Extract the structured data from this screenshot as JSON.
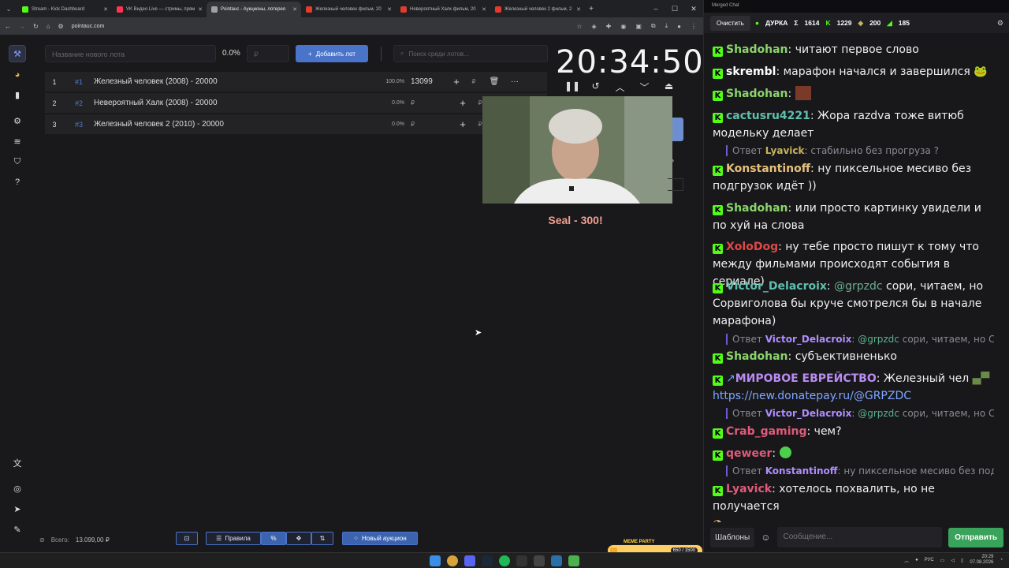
{
  "tabs": [
    {
      "label": "Stream - Kick Dashboard",
      "color": "#53fc18"
    },
    {
      "label": "VK Видео Live — стримы, прям",
      "color": "#ff3355"
    },
    {
      "label": "Pointauc - Аукционы, лотерея",
      "color": "#a0a0a0",
      "active": true
    },
    {
      "label": "Железный человек фильм, 20",
      "color": "#e23c2c"
    },
    {
      "label": "Невероятный Халк фильм, 20",
      "color": "#e23c2c"
    },
    {
      "label": "Железный человек 2 фильм, 2",
      "color": "#e23c2c"
    }
  ],
  "url": "pointauc.com",
  "controls": {
    "lot_placeholder": "Название нового лота",
    "percent": "0.0%",
    "amount_placeholder": "₽",
    "add_lot": "Добавить лот",
    "search_placeholder": "Поиск среди лотов..."
  },
  "lots": [
    {
      "num": "1",
      "id": "#1",
      "title": "Железный человек (2008) - 20000",
      "pct": "100.0%",
      "value": "13099",
      "cur": "₽"
    },
    {
      "num": "2",
      "id": "#2",
      "title": "Невероятный Халк (2008) - 20000",
      "pct": "0.0%",
      "value": "",
      "cur": "₽"
    },
    {
      "num": "3",
      "id": "#3",
      "title": "Железный человек 2 (2010) - 20000",
      "pct": "0.0%",
      "value": "",
      "cur": "₽"
    }
  ],
  "timer": "20:34:50",
  "seal": "Seal - 300!",
  "footer": {
    "total_label": "Всего:",
    "total_value": "13.099,00 ₽",
    "rules": "Правила",
    "new_auction": "Новый аукцион"
  },
  "chat": {
    "title": "Merged Chat",
    "clear": "Очистить",
    "streamer": "ДУРКА",
    "stats": [
      "1614",
      "1229",
      "200",
      "185"
    ],
    "templates": "Шаблоны",
    "input_placeholder": "Сообщение...",
    "send": "Отправить",
    "messages": [
      {
        "user": "Shadohan",
        "color": "#8bd36b",
        "text": "читают первое слово"
      },
      {
        "user": "skrembl",
        "color": "#fff",
        "text": "марафон начался и завершился"
      },
      {
        "user": "Shadohan",
        "color": "#8bd36b",
        "text": ""
      },
      {
        "user": "cactusru4221",
        "color": "#5fbfae",
        "text": "Жора razdva тоже витюб модельку делает"
      },
      {
        "user": "Konstantinoff",
        "color": "#e6c07a",
        "text": "ну пиксельное месиво без подгрузок идёт ))"
      },
      {
        "user": "Shadohan",
        "color": "#8bd36b",
        "text": "или просто картинку увидели и по хуй на слова"
      },
      {
        "user": "XoloDog",
        "color": "#e04848",
        "text": "ну тебе просто пишут к тому что между фильмами происходят события в сериале)"
      },
      {
        "user": "Victor_Delacroix",
        "color": "#5fbfae",
        "mention": "@grpzdc",
        "text": "сори, читаем, но Сорвиголова бы круче смотрелся бы в начале марафона)"
      },
      {
        "user": "Shadohan",
        "color": "#8bd36b",
        "text": "субъективненько"
      },
      {
        "user": "МИРОВОЕ ЕВРЕЙСТВО",
        "color": "#b88cf0",
        "text": "Железный чел",
        "link": "https://new.donatepay.ru/@GRPZDC"
      },
      {
        "user": "Crab_gaming",
        "color": "#e05a7a",
        "text": "чем?"
      },
      {
        "user": "qeweer",
        "color": "#e05a7a",
        "text": ""
      },
      {
        "user": "Lyavick",
        "color": "#e05a7a",
        "text": "хотелось похвалить, но не получается"
      }
    ],
    "replies": [
      {
        "label": "Ответ",
        "user": "Lyavick",
        "text": "стабильно без прогруза ?"
      },
      {
        "label": "Ответ",
        "user": "Victor_Delacroix",
        "mention": "@grpzdc",
        "text": "сори, читаем, но Сор..."
      },
      {
        "label": "Ответ",
        "user": "Victor_Delacroix",
        "mention": "@grpzdc",
        "text": "сори, читаем, но Сор..."
      },
      {
        "label": "Ответ",
        "user": "Konstantinoff",
        "text": "ну пиксельное месиво без подгру..."
      }
    ]
  },
  "taskbar": {
    "lang": "РУС",
    "time": "20:29",
    "date": "07.08.2026"
  },
  "hp": {
    "label": "MEME PARTY",
    "value": "650 / 1500"
  }
}
